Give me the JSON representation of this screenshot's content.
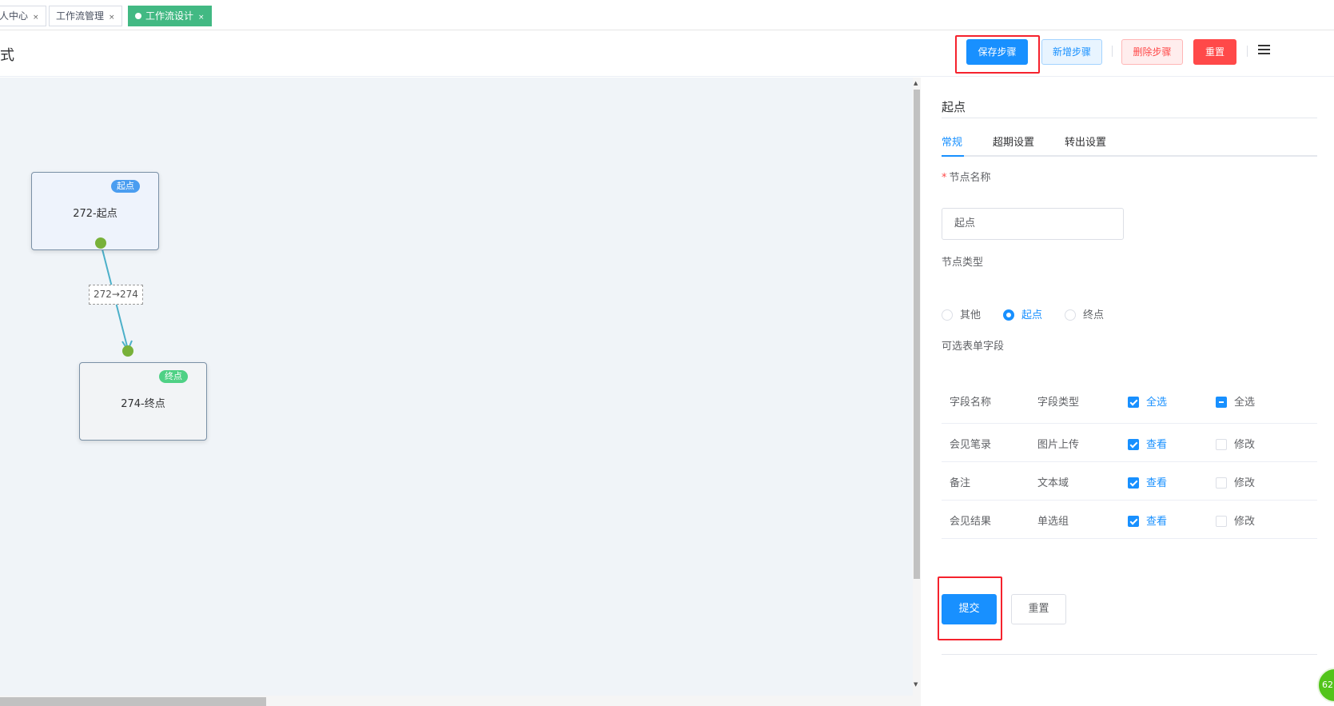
{
  "tabs": [
    {
      "label": "人中心",
      "close": "×"
    },
    {
      "label": "工作流管理",
      "close": "×"
    },
    {
      "label": "工作流设计",
      "close": "×",
      "active": true
    }
  ],
  "header": {
    "title": "式",
    "buttons": {
      "save_step": "保存步骤",
      "add_step": "新增步骤",
      "delete_step": "删除步骤",
      "reset": "重置"
    },
    "menu_icon": "hamburger-icon"
  },
  "canvas": {
    "nodes": [
      {
        "label": "272-起点",
        "badge": "起点"
      },
      {
        "label": "274-终点",
        "badge": "终点"
      }
    ],
    "edge_label": "272→274"
  },
  "panel": {
    "title": "起点",
    "tabs": [
      "常规",
      "超期设置",
      "转出设置"
    ],
    "active_tab": "常规",
    "node_name_label": "节点名称",
    "node_name_value": "起点",
    "node_type_label": "节点类型",
    "node_types": [
      "其他",
      "起点",
      "终点"
    ],
    "node_type_selected": "起点",
    "fields_label": "可选表单字段",
    "table": {
      "headers": [
        "字段名称",
        "字段类型",
        "全选",
        "全选"
      ],
      "rows": [
        {
          "name": "会见笔录",
          "type": "图片上传",
          "view": "查看",
          "edit": "修改"
        },
        {
          "name": "备注",
          "type": "文本域",
          "view": "查看",
          "edit": "修改"
        },
        {
          "name": "会见结果",
          "type": "单选组",
          "view": "查看",
          "edit": "修改"
        }
      ]
    },
    "submit": "提交",
    "reset": "重置"
  },
  "floating_badge": "62",
  "colors": {
    "primary": "#1890ff",
    "danger": "#ff4949",
    "tab_active": "#42b983",
    "edge": "#4cb0c9",
    "anchor": "#78b13a"
  }
}
